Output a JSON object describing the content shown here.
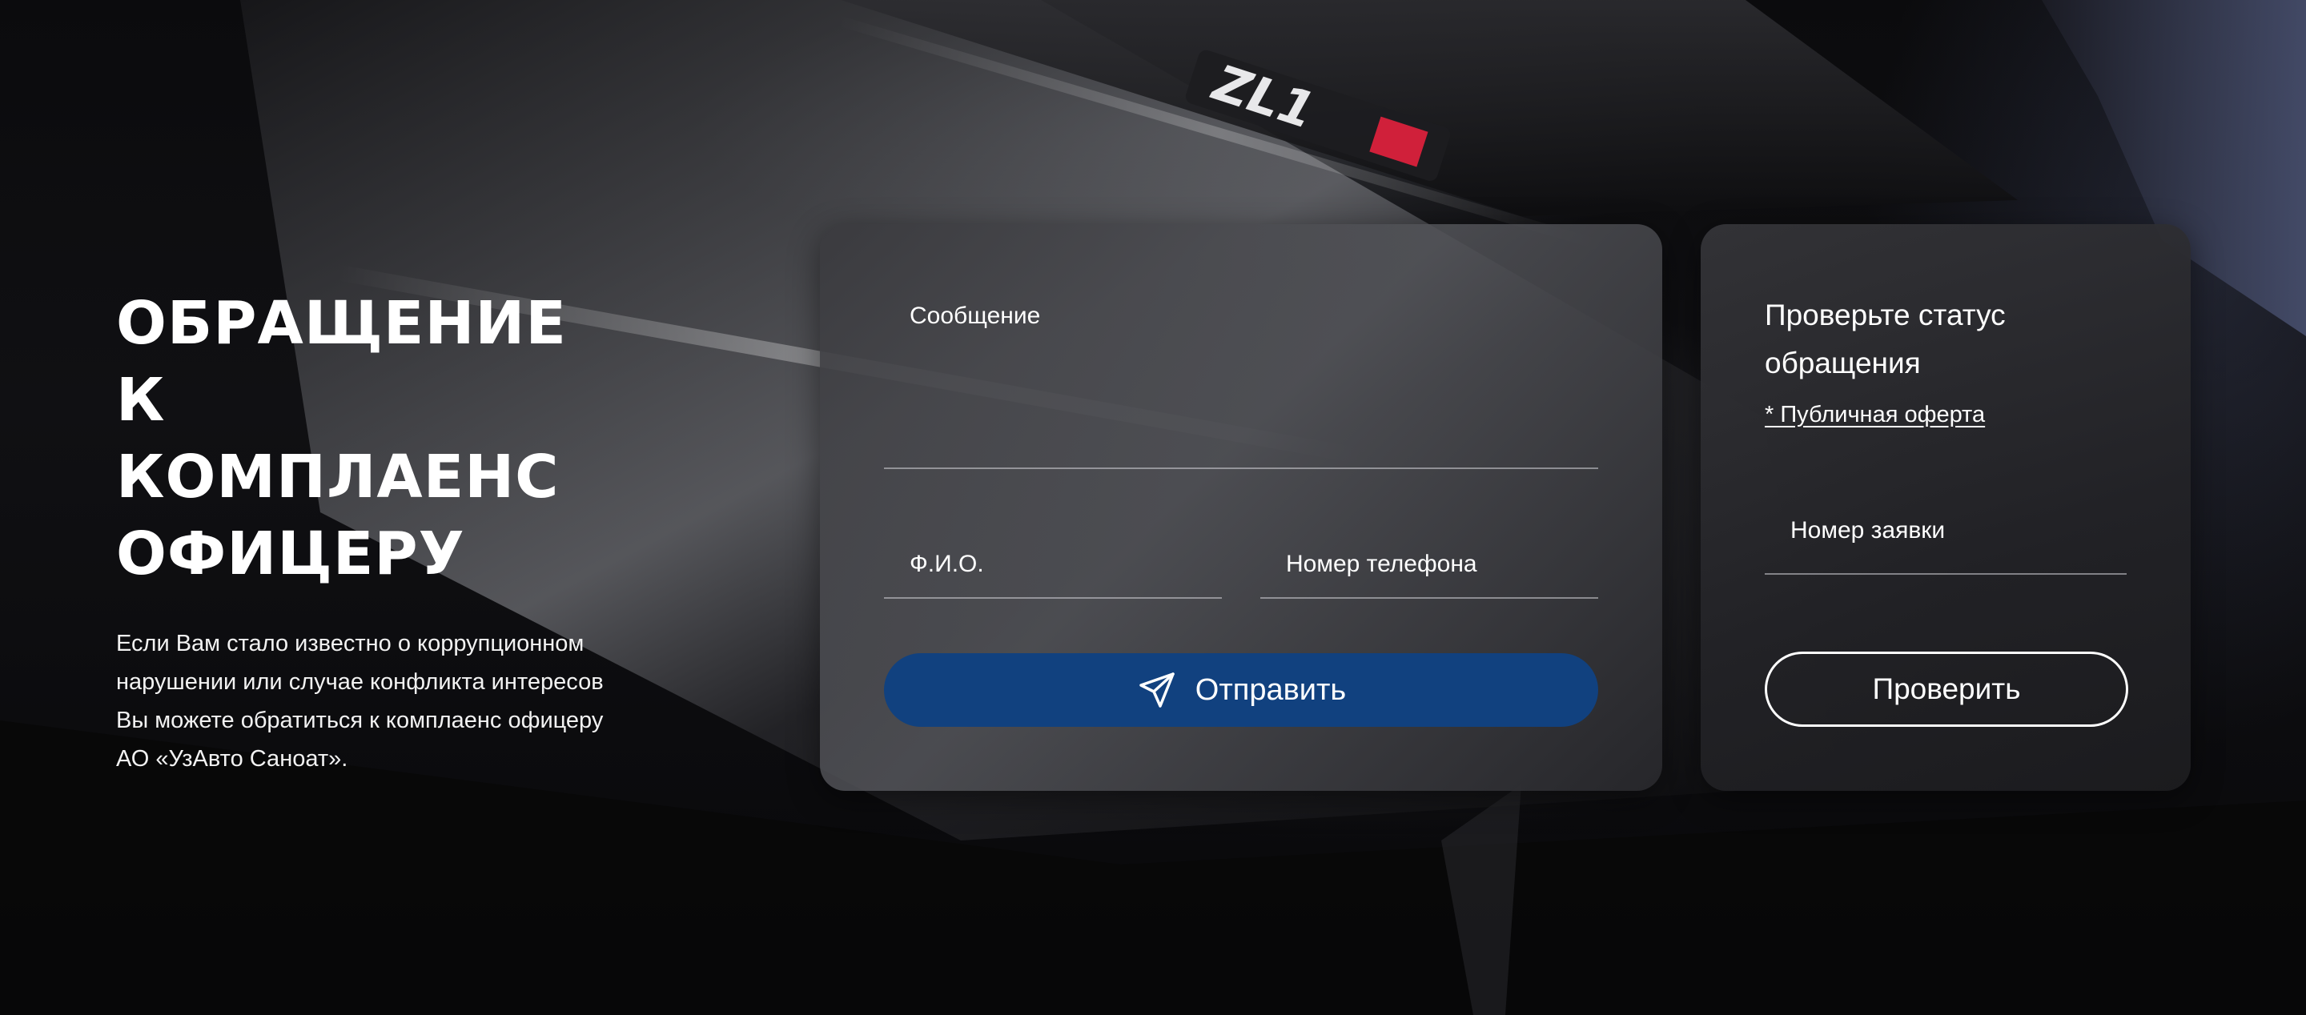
{
  "intro": {
    "title_lines": [
      "ОБРАЩЕНИЕ К",
      "КОМПЛАЕНС",
      "ОФИЦЕРУ"
    ],
    "description": "Если Вам стало известно о коррупционном нарушении или случае конфликта интересов Вы можете обратиться к комплаенс офицеру АО «УзАвто Саноат»."
  },
  "form": {
    "message_label": "Сообщение",
    "name_label": "Ф.И.О.",
    "phone_label": "Номер телефона",
    "submit_label": "Отправить",
    "submit_icon": "paper-plane-icon",
    "button_color": "#11417f"
  },
  "status": {
    "title": "Проверьте статус обращения",
    "offer_link": "* Публичная оферта",
    "order_label": "Номер заявки",
    "check_label": "Проверить"
  },
  "background": {
    "badge_text": "ZL1"
  }
}
